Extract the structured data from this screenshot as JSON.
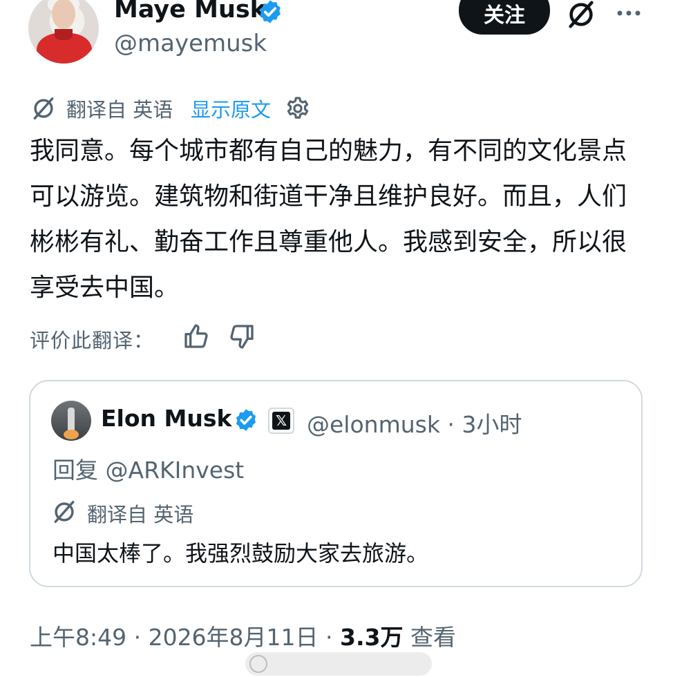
{
  "author": {
    "name": "Maye Musk",
    "handle": "@mayemusk"
  },
  "actions": {
    "follow_label": "关注"
  },
  "translation": {
    "from_label": "翻译自 英语",
    "show_original": "显示原文"
  },
  "tweet": {
    "text": "我同意。每个城市都有自己的魅力，有不同的文化景点可以游览。建筑物和街道干净且维护良好。而且，人们彬彬有礼、勤奋工作且尊重他人。我感到安全，所以很享受去中国。"
  },
  "rating": {
    "label": "评价此翻译："
  },
  "quoted": {
    "name": "Elon Musk",
    "handle_time": "@elonmusk · 3小时",
    "reply_to": "回复 @ARKInvest",
    "translation_label": "翻译自 英语",
    "text": "中国太棒了。我强烈鼓励大家去旅游。"
  },
  "meta": {
    "time_date": "上午8:49 · 2026年8月11日 · ",
    "views_count": "3.3万",
    "views_label": "查看"
  },
  "colors": {
    "text": "#0f1419",
    "secondary": "#536471",
    "link": "#1d9bf0",
    "verified": "#1d9bf0",
    "border": "#cfd9de"
  }
}
